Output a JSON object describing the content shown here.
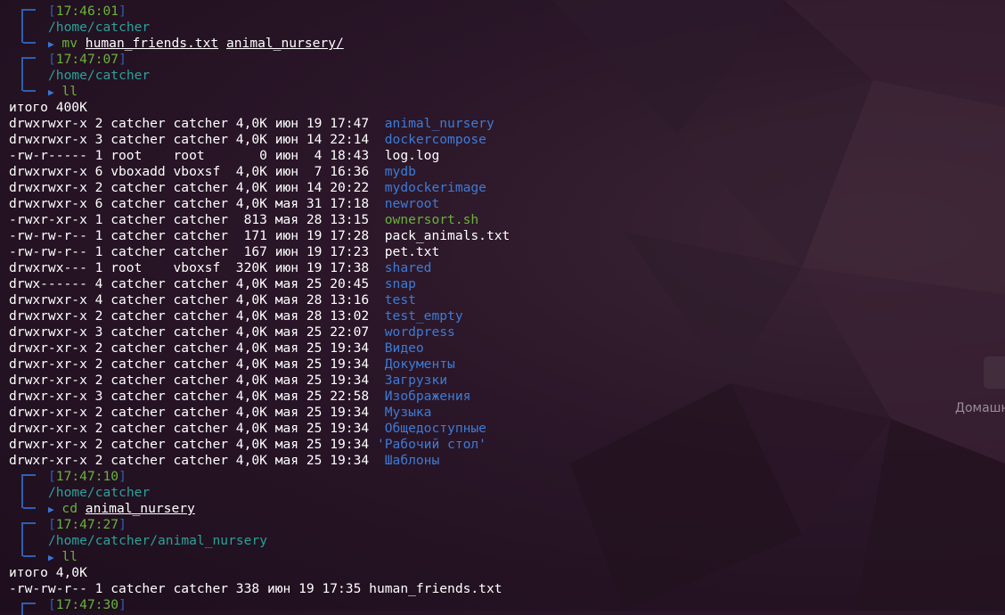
{
  "blocks": [
    {
      "time": "17:46:01",
      "path": "/home/catcher",
      "cmd": "mv",
      "args": [
        "human_friends.txt",
        "animal_nursery/"
      ]
    },
    {
      "time": "17:47:07",
      "path": "/home/catcher",
      "cmd": "ll",
      "args": []
    },
    {
      "time": "17:47:10",
      "path": "/home/catcher",
      "cmd": "cd",
      "args": [
        "animal_nursery"
      ]
    },
    {
      "time": "17:47:27",
      "path": "/home/catcher/animal_nursery",
      "cmd": "ll",
      "args": []
    },
    {
      "time": "17:47:30"
    }
  ],
  "listing1": {
    "total": "итого 400K",
    "rows": [
      {
        "meta": "drwxrwxr-x 2 catcher catcher 4,0K июн 19 17:47  ",
        "name": "animal_nursery",
        "kind": "dir"
      },
      {
        "meta": "drwxrwxr-x 3 catcher catcher 4,0K июн 14 22:14  ",
        "name": "dockercompose",
        "kind": "dir"
      },
      {
        "meta": "-rw-r----- 1 root    root       0 июн  4 18:43  ",
        "name": "log.log",
        "kind": "file"
      },
      {
        "meta": "drwxrwxr-x 6 vboxadd vboxsf  4,0K июн  7 16:36  ",
        "name": "mydb",
        "kind": "dir"
      },
      {
        "meta": "drwxrwxr-x 2 catcher catcher 4,0K июн 14 20:22  ",
        "name": "mydockerimage",
        "kind": "dir"
      },
      {
        "meta": "drwxrwxr-x 6 catcher catcher 4,0K мая 31 17:18  ",
        "name": "newroot",
        "kind": "dir"
      },
      {
        "meta": "-rwxr-xr-x 1 catcher catcher  813 мая 28 13:15  ",
        "name": "ownersort.sh",
        "kind": "exe"
      },
      {
        "meta": "-rw-rw-r-- 1 catcher catcher  171 июн 19 17:28  ",
        "name": "pack_animals.txt",
        "kind": "file"
      },
      {
        "meta": "-rw-rw-r-- 1 catcher catcher  167 июн 19 17:23  ",
        "name": "pet.txt",
        "kind": "file"
      },
      {
        "meta": "drwxrwx--- 1 root    vboxsf  320K июн 19 17:38  ",
        "name": "shared",
        "kind": "dir"
      },
      {
        "meta": "drwx------ 4 catcher catcher 4,0K мая 25 20:45  ",
        "name": "snap",
        "kind": "dir"
      },
      {
        "meta": "drwxrwxr-x 4 catcher catcher 4,0K мая 28 13:16  ",
        "name": "test",
        "kind": "dir"
      },
      {
        "meta": "drwxrwxr-x 2 catcher catcher 4,0K мая 28 13:02  ",
        "name": "test_empty",
        "kind": "dir"
      },
      {
        "meta": "drwxrwxr-x 3 catcher catcher 4,0K мая 25 22:07  ",
        "name": "wordpress",
        "kind": "dir"
      },
      {
        "meta": "drwxr-xr-x 2 catcher catcher 4,0K мая 25 19:34  ",
        "name": "Видео",
        "kind": "dir"
      },
      {
        "meta": "drwxr-xr-x 2 catcher catcher 4,0K мая 25 19:34  ",
        "name": "Документы",
        "kind": "dir"
      },
      {
        "meta": "drwxr-xr-x 2 catcher catcher 4,0K мая 25 19:34  ",
        "name": "Загрузки",
        "kind": "dir"
      },
      {
        "meta": "drwxr-xr-x 3 catcher catcher 4,0K мая 25 22:58  ",
        "name": "Изображения",
        "kind": "dir"
      },
      {
        "meta": "drwxr-xr-x 2 catcher catcher 4,0K мая 25 19:34  ",
        "name": "Музыка",
        "kind": "dir"
      },
      {
        "meta": "drwxr-xr-x 2 catcher catcher 4,0K мая 25 19:34  ",
        "name": "Общедоступные",
        "kind": "dir"
      },
      {
        "meta": "drwxr-xr-x 2 catcher catcher 4,0K мая 25 19:34 ",
        "name": "'Рабочий стол'",
        "kind": "dir"
      },
      {
        "meta": "drwxr-xr-x 2 catcher catcher 4,0K мая 25 19:34  ",
        "name": "Шаблоны",
        "kind": "dir"
      }
    ]
  },
  "listing2": {
    "total": "итого 4,0K",
    "rows": [
      {
        "meta": "-rw-rw-r-- 1 catcher catcher 338 июн 19 17:35 ",
        "name": "human_friends.txt",
        "kind": "file"
      }
    ]
  },
  "side_label": "Домашн",
  "colors": {
    "background": "#2a1628",
    "dir": "#3d7bd6",
    "exe": "#6bb23a",
    "time": "#6bb23a",
    "path": "#2aa198",
    "bracket": "#2f5fb0"
  }
}
